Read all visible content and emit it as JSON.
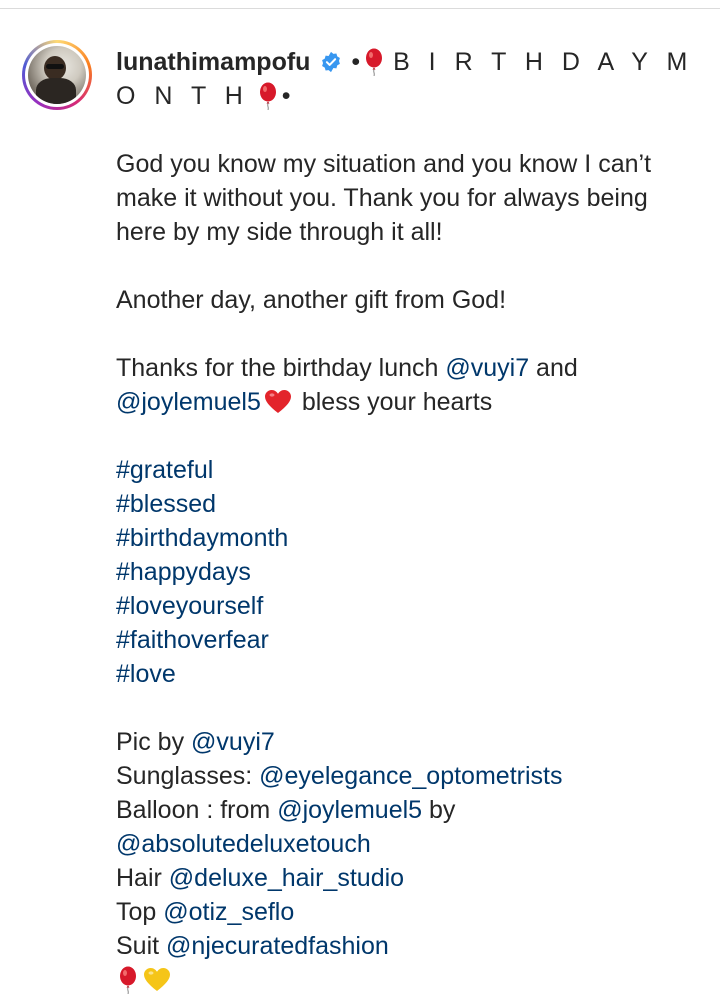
{
  "post": {
    "username": "lunathimampofu",
    "title_prefix": "•",
    "title_text": "B I R T H D A Y M O N T H",
    "title_suffix": "•"
  },
  "caption": {
    "p1": "God you know my situation and you know I can’t make it without you. Thank you for always being here by my side through it all!",
    "p2": "Another day, another gift from God!",
    "p3_a": "Thanks for the birthday lunch ",
    "p3_mention1": "@vuyi7",
    "p3_b": " and",
    "p3_mention2": "@joylemuel5",
    "p3_c": " bless your hearts",
    "hashtags": [
      "#grateful",
      "#blessed",
      "#birthdaymonth",
      "#happydays",
      "#loveyourself",
      "#faithoverfear",
      "#love"
    ],
    "credits": {
      "pic_label": "Pic by ",
      "pic_mention": "@vuyi7",
      "sunglasses_label": "Sunglasses: ",
      "sunglasses_mention": "@eyelegance_optometrists",
      "balloon_label": "Balloon : from ",
      "balloon_mention1": "@joylemuel5",
      "balloon_by": " by",
      "balloon_mention2": "@absolutedeluxetouch",
      "hair_label": "Hair ",
      "hair_mention": "@deluxe_hair_studio",
      "top_label": "Top ",
      "top_mention": "@otiz_seflo",
      "suit_label": "Suit ",
      "suit_mention": "@njecuratedfashion"
    }
  },
  "colors": {
    "link": "#00376b",
    "text": "#262626",
    "verified": "#3897f0"
  },
  "icons": [
    "verified-badge-icon",
    "balloon-icon",
    "red-heart-icon",
    "yellow-heart-icon"
  ]
}
